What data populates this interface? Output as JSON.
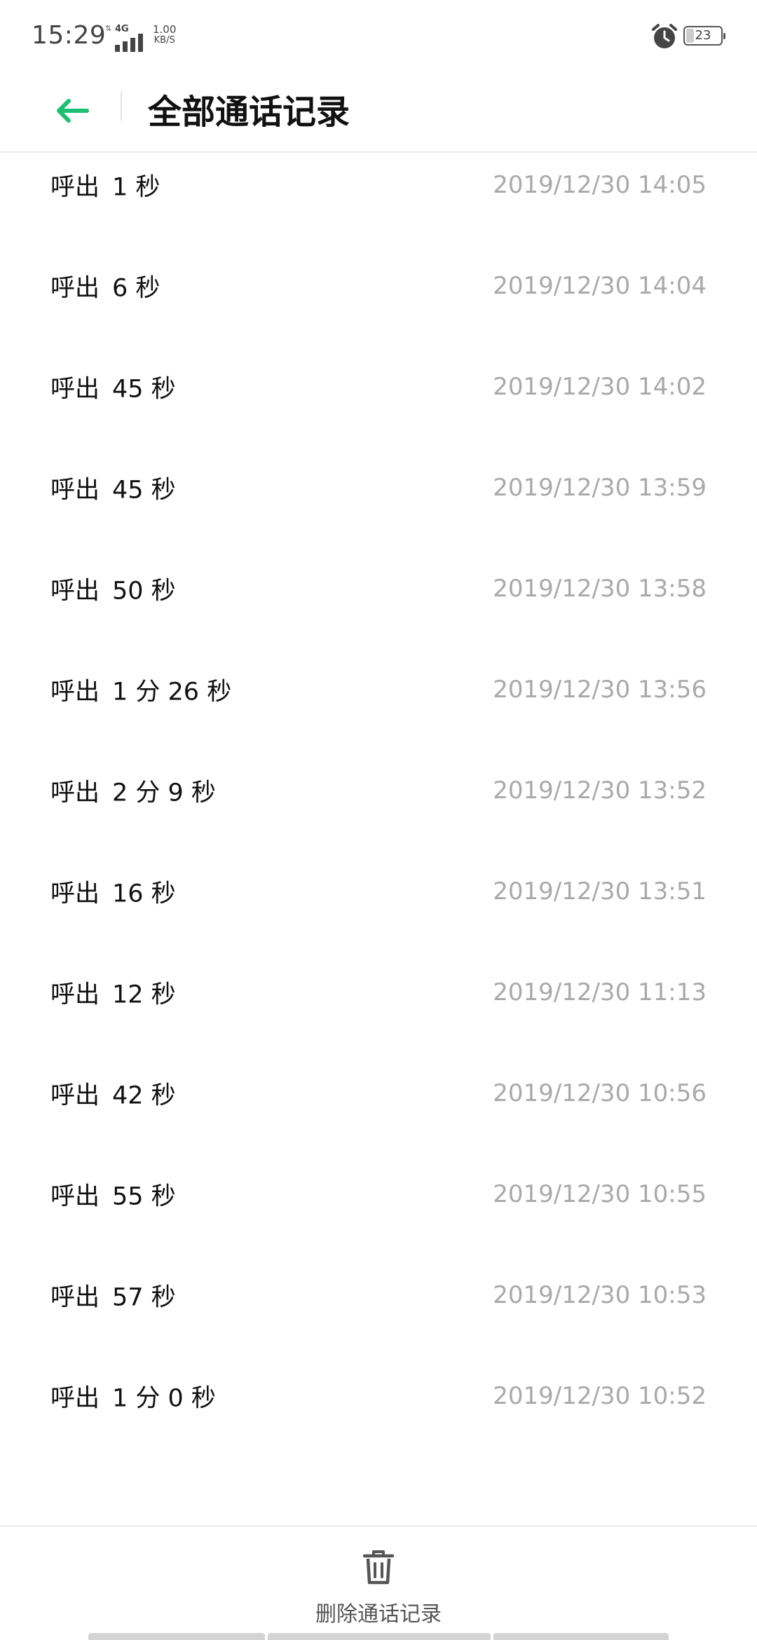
{
  "status_bar": {
    "time": "15:29",
    "network": "4G",
    "speed_value": "1.00",
    "speed_unit": "KB/S",
    "alarm_icon": "alarm-clock-icon",
    "battery": "23",
    "battery_level": 0.23
  },
  "header": {
    "back_icon": "arrow-left-icon",
    "title": "全部通话记录"
  },
  "call_log": [
    {
      "type": "呼出",
      "duration": "1 秒",
      "time": "2019/12/30 14:05"
    },
    {
      "type": "呼出",
      "duration": "6 秒",
      "time": "2019/12/30 14:04"
    },
    {
      "type": "呼出",
      "duration": "45 秒",
      "time": "2019/12/30 14:02"
    },
    {
      "type": "呼出",
      "duration": "45 秒",
      "time": "2019/12/30 13:59"
    },
    {
      "type": "呼出",
      "duration": "50 秒",
      "time": "2019/12/30 13:58"
    },
    {
      "type": "呼出",
      "duration": "1 分 26 秒",
      "time": "2019/12/30 13:56"
    },
    {
      "type": "呼出",
      "duration": "2 分 9 秒",
      "time": "2019/12/30 13:52"
    },
    {
      "type": "呼出",
      "duration": "16 秒",
      "time": "2019/12/30 13:51"
    },
    {
      "type": "呼出",
      "duration": "12 秒",
      "time": "2019/12/30 11:13"
    },
    {
      "type": "呼出",
      "duration": "42 秒",
      "time": "2019/12/30 10:56"
    },
    {
      "type": "呼出",
      "duration": "55 秒",
      "time": "2019/12/30 10:55"
    },
    {
      "type": "呼出",
      "duration": "57 秒",
      "time": "2019/12/30 10:53"
    },
    {
      "type": "呼出",
      "duration": "1 分 0 秒",
      "time": "2019/12/30 10:52"
    }
  ],
  "bottom_bar": {
    "delete_icon": "trash-icon",
    "delete_label": "删除通话记录"
  },
  "colors": {
    "accent": "#1fbf73",
    "time_text": "#a9a9a9"
  }
}
